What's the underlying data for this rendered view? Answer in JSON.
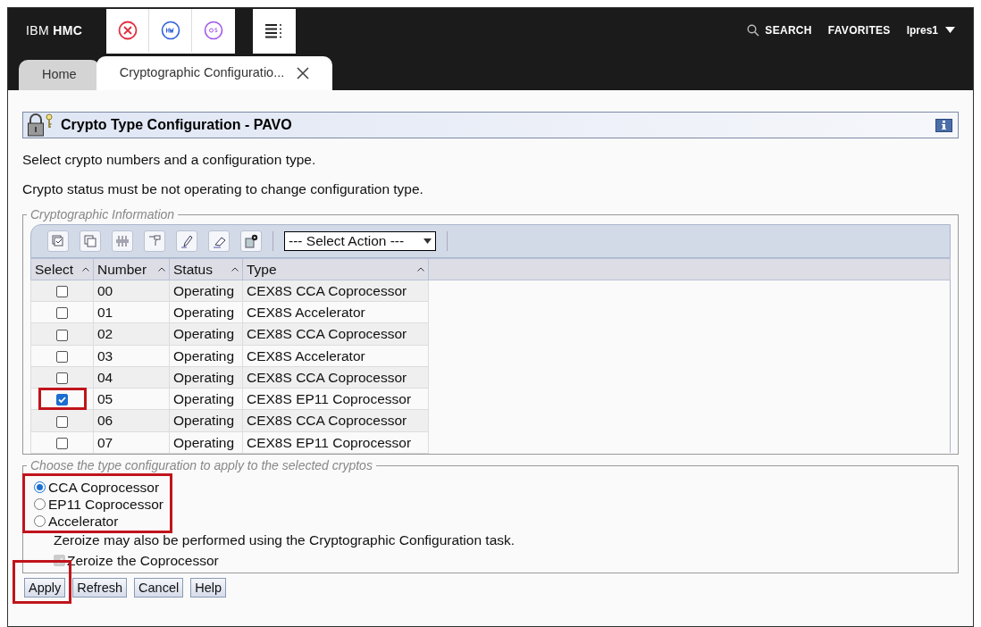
{
  "header": {
    "brand_light": "IBM",
    "brand_bold": "HMC",
    "search": "SEARCH",
    "favorites": "FAVORITES",
    "user": "lpres1"
  },
  "tabs": [
    {
      "label": "Home",
      "selected": false
    },
    {
      "label": "Cryptographic Configuratio...",
      "selected": true,
      "closable": true
    }
  ],
  "panel": {
    "title": "Crypto Type Configuration - PAVO"
  },
  "instructions": [
    "Select crypto numbers and a configuration type.",
    "Crypto status must be not operating to change configuration type."
  ],
  "crypto_info": {
    "legend": "Cryptographic Information",
    "action_select": "--- Select Action ---",
    "columns": [
      "Select",
      "Number",
      "Status",
      "Type"
    ],
    "rows": [
      {
        "checked": false,
        "highlighted": false,
        "number": "00",
        "status": "Operating",
        "type": "CEX8S CCA Coprocessor"
      },
      {
        "checked": false,
        "highlighted": false,
        "number": "01",
        "status": "Operating",
        "type": "CEX8S Accelerator"
      },
      {
        "checked": false,
        "highlighted": false,
        "number": "02",
        "status": "Operating",
        "type": "CEX8S CCA Coprocessor"
      },
      {
        "checked": false,
        "highlighted": false,
        "number": "03",
        "status": "Operating",
        "type": "CEX8S Accelerator"
      },
      {
        "checked": false,
        "highlighted": false,
        "number": "04",
        "status": "Operating",
        "type": "CEX8S CCA Coprocessor"
      },
      {
        "checked": true,
        "highlighted": true,
        "number": "05",
        "status": "Operating",
        "type": "CEX8S EP11 Coprocessor"
      },
      {
        "checked": false,
        "highlighted": false,
        "number": "06",
        "status": "Operating",
        "type": "CEX8S CCA Coprocessor"
      },
      {
        "checked": false,
        "highlighted": false,
        "number": "07",
        "status": "Operating",
        "type": "CEX8S EP11 Coprocessor"
      }
    ]
  },
  "type_config": {
    "legend": "Choose the type configuration to apply to the selected cryptos",
    "highlighted": true,
    "options": [
      {
        "label": "CCA Coprocessor",
        "selected": true
      },
      {
        "label": "EP11 Coprocessor",
        "selected": false
      },
      {
        "label": "Accelerator",
        "selected": false
      }
    ],
    "note": "Zeroize may also be performed using the Cryptographic Configuration task.",
    "zeroize": {
      "label": "Zeroize the Coprocessor",
      "checked": true,
      "disabled": true
    }
  },
  "buttons": [
    {
      "label": "Apply",
      "highlighted": true
    },
    {
      "label": "Refresh",
      "highlighted": false
    },
    {
      "label": "Cancel",
      "highlighted": false
    },
    {
      "label": "Help",
      "highlighted": false
    }
  ]
}
